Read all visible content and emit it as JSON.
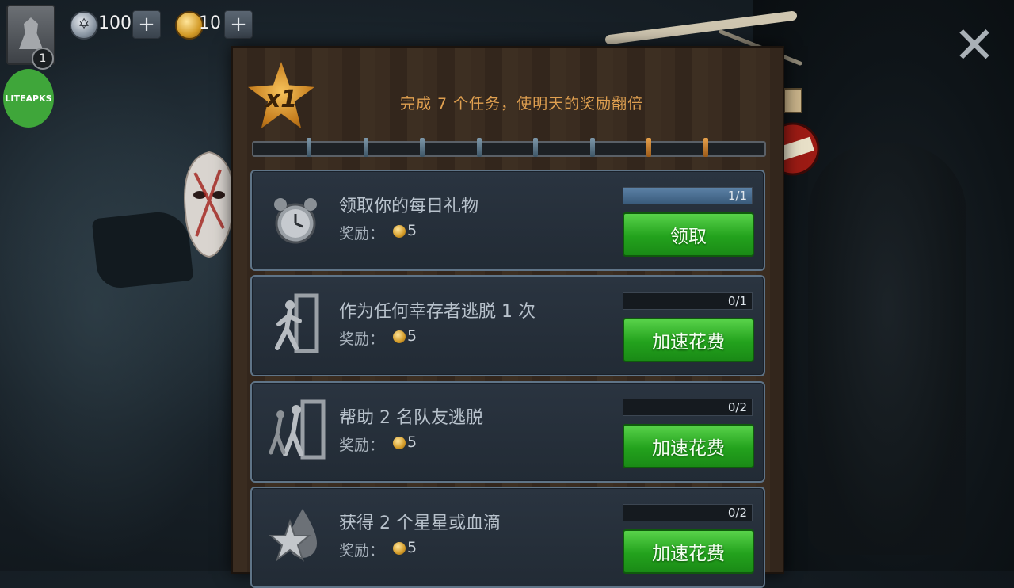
{
  "top_bar": {
    "level": "1",
    "watermark": "LITEAPKS",
    "shards": "100",
    "coins": "10",
    "add_label": "+",
    "close_label": "✕"
  },
  "panel": {
    "multiplier": "x1",
    "header": "完成 7 个任务，使明天的奖励翻倍",
    "progress": {
      "total_ticks": 8,
      "completed_ticks": 2
    }
  },
  "tasks": [
    {
      "icon": "alarm-clock-icon",
      "title": "领取你的每日礼物",
      "reward_label": "奖励：",
      "reward_value": "5",
      "progress_text": "1/1",
      "progress": 1.0,
      "button": "领取"
    },
    {
      "icon": "escape-door-icon",
      "title": "作为任何幸存者逃脱 1 次",
      "reward_label": "奖励：",
      "reward_value": "5",
      "progress_text": "0/1",
      "progress": 0.0,
      "button": "加速花费"
    },
    {
      "icon": "team-escape-icon",
      "title": "帮助 2 名队友逃脱",
      "reward_label": "奖励：",
      "reward_value": "5",
      "progress_text": "0/2",
      "progress": 0.0,
      "button": "加速花费"
    },
    {
      "icon": "star-drop-icon",
      "title": "获得 2 个星星或血滴",
      "reward_label": "奖励：",
      "reward_value": "5",
      "progress_text": "0/2",
      "progress": 0.0,
      "button": "加速花费"
    }
  ],
  "colors": {
    "accent_orange": "#e0a050",
    "button_green": "#23a21d",
    "card_border": "#5f7487"
  }
}
